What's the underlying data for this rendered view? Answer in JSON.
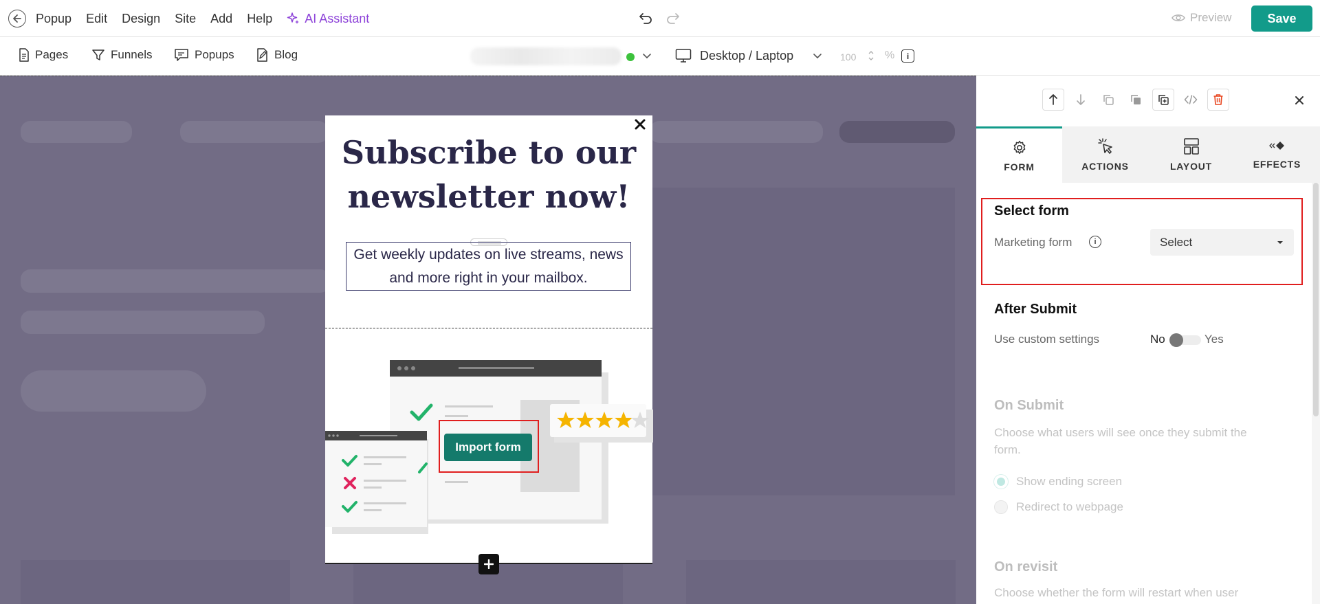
{
  "menu": {
    "items": [
      "Popup",
      "Edit",
      "Design",
      "Site",
      "Add",
      "Help"
    ],
    "ai_assistant": "AI Assistant"
  },
  "header_actions": {
    "preview_label": "Preview",
    "save_label": "Save"
  },
  "nav": {
    "pages": "Pages",
    "funnels": "Funnels",
    "popups": "Popups",
    "blog": "Blog"
  },
  "toolbar": {
    "device_label": "Desktop / Laptop",
    "zoom_value": "100",
    "zoom_unit": "%",
    "status_color": "#3cc23c"
  },
  "popup": {
    "title": "Subscribe to our newsletter now!",
    "description": "Get weekly updates on live streams, news and more right in your mailbox.",
    "import_button": "Import form",
    "rating": 4,
    "rating_max": 5
  },
  "panel": {
    "tabs": [
      {
        "label": "FORM",
        "icon": "gear-icon",
        "active": true
      },
      {
        "label": "ACTIONS",
        "icon": "cursor-click-icon",
        "active": false
      },
      {
        "label": "LAYOUT",
        "icon": "layout-icon",
        "active": false
      },
      {
        "label": "EFFECTS",
        "icon": "effects-icon",
        "active": false
      }
    ],
    "select_form": {
      "title": "Select form",
      "field_label": "Marketing form",
      "select_value": "Select"
    },
    "after_submit": {
      "title": "After Submit",
      "field_label": "Use custom settings",
      "toggle_off": "No",
      "toggle_on": "Yes",
      "toggle_value": false
    },
    "on_submit": {
      "title": "On Submit",
      "description": "Choose what users will see once they submit the form.",
      "options": [
        "Show ending screen",
        "Redirect to webpage"
      ],
      "selected": 0
    },
    "on_revisit": {
      "title": "On revisit",
      "description": "Choose whether the form will restart when user"
    }
  },
  "colors": {
    "accent": "#129b8a",
    "ai": "#8e44d9",
    "canvas": "#726c85",
    "highlight": "#e01e1e",
    "title_text": "#2a2748"
  }
}
